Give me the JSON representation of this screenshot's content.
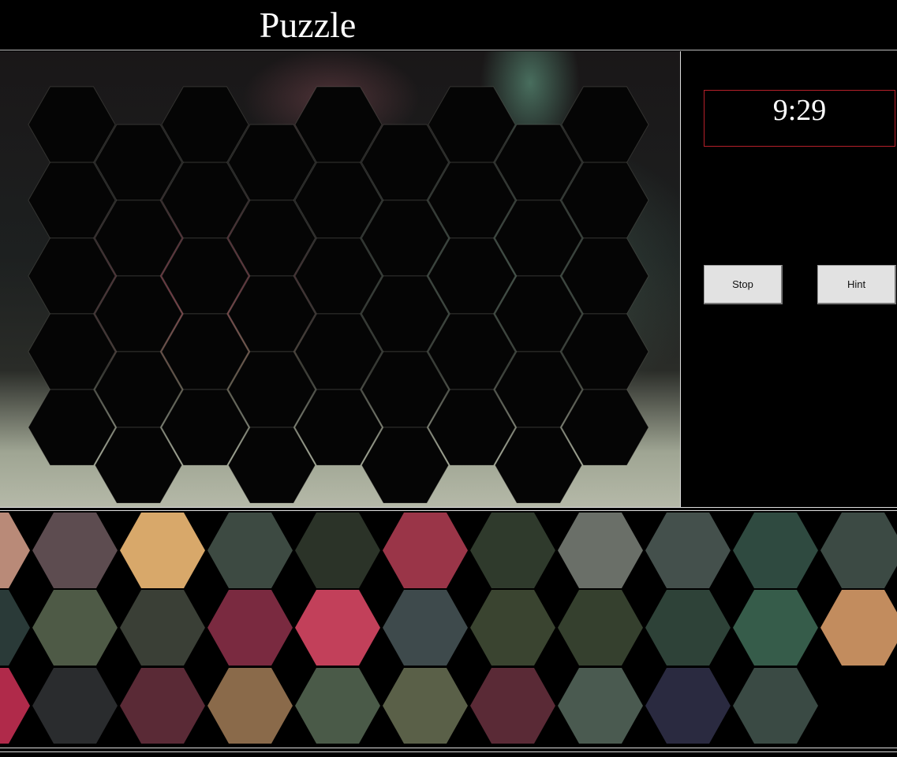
{
  "header": {
    "title": "Puzzle"
  },
  "timer": {
    "value": "9:29"
  },
  "buttons": {
    "stop_label": "Stop",
    "hint_label": "Hint"
  },
  "colors": {
    "timer_border": "#b5202a",
    "background": "#000000",
    "divider": "#dddddd"
  },
  "board": {
    "columns": 9,
    "rows": 5,
    "placed_pieces": 0
  },
  "tray": {
    "rows": [
      {
        "pieces": [
          "#b98a78",
          "#5d4c50",
          "#d8a86a",
          "#3d4a42",
          "#2b3328",
          "#9a3548",
          "#2f3a2c",
          "#6a6f68",
          "#44504c",
          "#2f4a40",
          "#3c4a44"
        ]
      },
      {
        "pieces": [
          "#2a3a38",
          "#4e5a46",
          "#3a3f36",
          "#7a2a40",
          "#c2405a",
          "#3e4a4c",
          "#3a4430",
          "#35402e",
          "#2e4238",
          "#365c4a",
          "#c28c5e"
        ]
      },
      {
        "pieces": [
          "#b02a4a",
          "#2a2c2e",
          "#5a2a36",
          "#8a6a4a",
          "#4a5a48",
          "#5a6048",
          "#5a2a36",
          "#4a5a50",
          "#2a2a40",
          "#3a4a44"
        ]
      }
    ]
  }
}
